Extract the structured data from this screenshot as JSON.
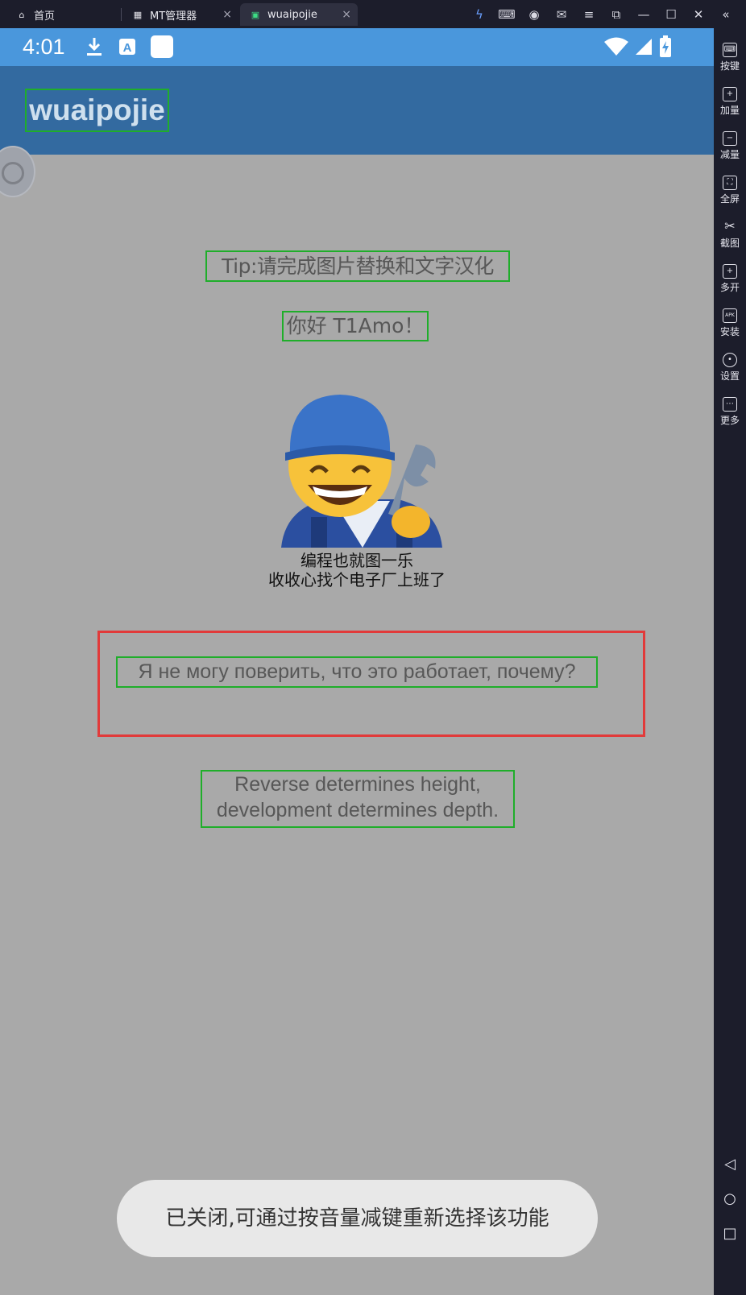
{
  "tabs": [
    {
      "label": "首页"
    },
    {
      "label": "MT管理器"
    },
    {
      "label": "wuaipojie"
    }
  ],
  "window_controls": {
    "minimize": "—",
    "maximize": "☐",
    "close": "✕"
  },
  "status_bar": {
    "time": "4:01"
  },
  "app_bar": {
    "title": "wuaipojie"
  },
  "content": {
    "tip": "Tip:请完成图片替换和文字汉化",
    "hello": "你好 T1Amo！",
    "caption_line1": "编程也就图一乐",
    "caption_line2": "收收心找个电子厂上班了",
    "russian": "Я не могу поверить, что это работает, почему?",
    "reverse_line1": "Reverse determines height,",
    "reverse_line2": "development determines depth."
  },
  "toast": "已关闭,可通过按音量减键重新选择该功能",
  "sidebar": {
    "items": [
      {
        "label": "按键",
        "icon": "keyboard-icon"
      },
      {
        "label": "加量",
        "icon": "volume-up-icon"
      },
      {
        "label": "减量",
        "icon": "volume-down-icon"
      },
      {
        "label": "全屏",
        "icon": "fullscreen-icon"
      },
      {
        "label": "截图",
        "icon": "scissors-icon"
      },
      {
        "label": "多开",
        "icon": "multi-open-icon"
      },
      {
        "label": "安装",
        "icon": "apk-install-icon"
      },
      {
        "label": "设置",
        "icon": "settings-icon"
      },
      {
        "label": "更多",
        "icon": "more-icon"
      }
    ]
  },
  "colors": {
    "status_bar": "#4a97dc",
    "app_bar": "#336aa0",
    "background": "#a9a9a9",
    "highlight_green": "#1fae2a",
    "highlight_red": "#e23a3a"
  }
}
